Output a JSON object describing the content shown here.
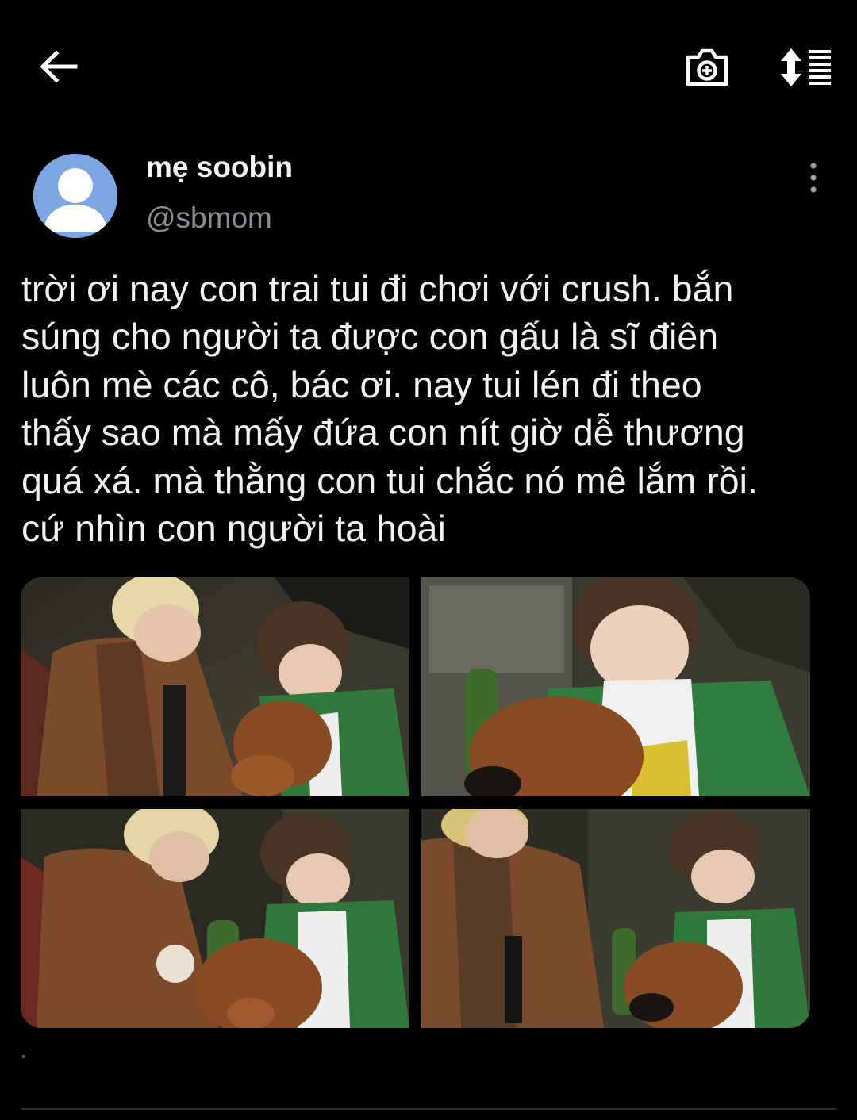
{
  "toolbar": {
    "back_icon": "arrow-left-icon",
    "screenshot_icon": "camera-plus-icon",
    "sort_icon": "sort-list-icon"
  },
  "post": {
    "display_name": "mẹ soobin",
    "handle": "@sbmom",
    "more_icon": "more-vertical-icon",
    "text_lines": [
      "trời ơi nay con trai tui đi chơi với crush. bắn",
      "súng cho người ta được con gấu là sĩ điên",
      "luôn mè các cô, bác ơi. nay tui lén đi theo",
      "thấy sao mà mấy đứa con nít giờ dễ thương",
      "quá xá. mà thằng con tui chắc nó mê lắm rồi.",
      "cứ nhìn con người ta hoài"
    ],
    "media_count": 4
  },
  "colors": {
    "background": "#000000",
    "text": "#f1f1f1",
    "handle": "#8b8f95",
    "avatar": "#7aa6e3"
  }
}
